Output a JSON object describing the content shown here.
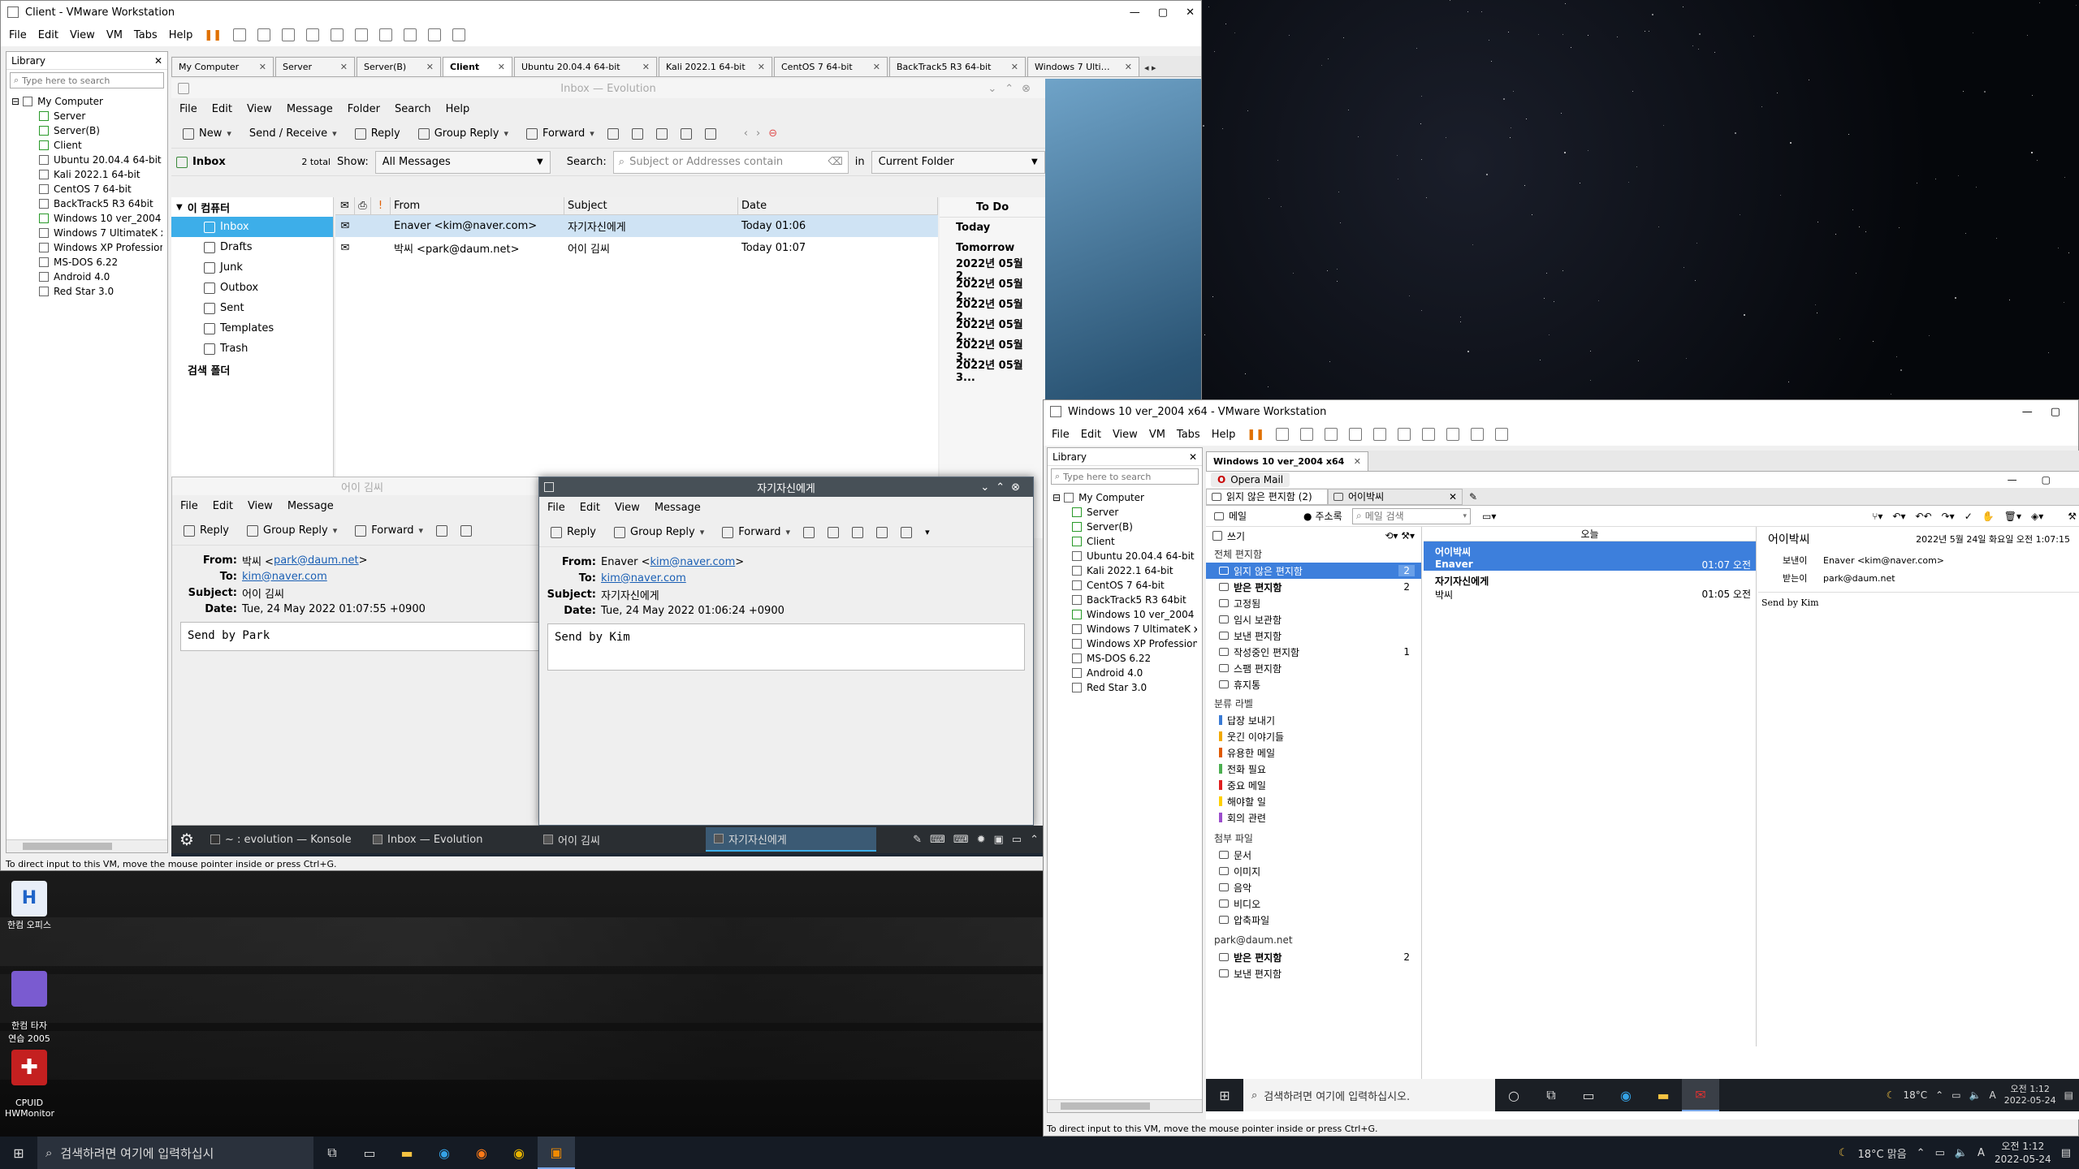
{
  "host": {
    "desktop_icons": [
      {
        "label": "한컴 오피스"
      },
      {
        "label": "한컴 타자\n연습 2005"
      },
      {
        "label": "CPUID\nHWMonitor"
      }
    ],
    "taskbar": {
      "search_placeholder": "검색하려면 여기에 입력하십시",
      "weather": "18°C 맑음",
      "time": "오전 1:12",
      "date": "2022-05-24"
    }
  },
  "vm1": {
    "title": "Client - VMware Workstation",
    "menu": [
      "File",
      "Edit",
      "View",
      "VM",
      "Tabs",
      "Help"
    ],
    "library": {
      "title": "Library",
      "search_placeholder": "Type here to search",
      "root": "My Computer",
      "items": [
        "Server",
        "Server(B)",
        "Client",
        "Ubuntu 20.04.4 64-bit",
        "Kali 2022.1 64-bit",
        "CentOS 7 64-bit",
        "BackTrack5 R3 64bit",
        "Windows 10 ver_2004 x",
        "Windows 7 UltimateK x",
        "Windows XP Profession",
        "MS-DOS 6.22",
        "Android 4.0",
        "Red Star 3.0"
      ]
    },
    "tabs": [
      "My Computer",
      "Server",
      "Server(B)",
      "Client",
      "Ubuntu 20.04.4 64-bit",
      "Kali 2022.1 64-bit",
      "CentOS 7 64-bit",
      "BackTrack5 R3 64-bit",
      "Windows 7 Ultima..."
    ],
    "status": "To direct input to this VM, move the mouse pointer inside or press Ctrl+G."
  },
  "evolution": {
    "title": "Inbox — Evolution",
    "menu": [
      "File",
      "Edit",
      "View",
      "Message",
      "Folder",
      "Search",
      "Help"
    ],
    "toolbar": {
      "new": "New",
      "send_receive": "Send / Receive",
      "reply": "Reply",
      "group_reply": "Group Reply",
      "forward": "Forward"
    },
    "inbox_label": "Inbox",
    "total": "2 total",
    "show_label": "Show:",
    "show_value": "All Messages",
    "search_label": "Search:",
    "search_placeholder": "Subject or Addresses contain",
    "in_label": "in",
    "scope": "Current Folder",
    "account": "이 컴퓨터",
    "folders": [
      "Inbox",
      "Drafts",
      "Junk",
      "Outbox",
      "Sent",
      "Templates",
      "Trash"
    ],
    "search_folders": "검색 폴더",
    "columns": {
      "from": "From",
      "subject": "Subject",
      "date": "Date"
    },
    "messages": [
      {
        "from": "Enaver <kim@naver.com>",
        "subject": "자기자신에게",
        "date": "Today 01:06"
      },
      {
        "from": "박씨 <park@daum.net>",
        "subject": "어이 김씨",
        "date": "Today 01:07"
      }
    ],
    "todo": {
      "title": "To Do",
      "items": [
        "Today",
        "Tomorrow",
        "2022년 05월 2...",
        "2022년 05월 2...",
        "2022년 05월 2...",
        "2022년 05월 2...",
        "2022년 05월 3...",
        "2022년 05월 3..."
      ]
    }
  },
  "compose_park": {
    "title": "어이 김씨",
    "menu": [
      "File",
      "Edit",
      "View",
      "Message"
    ],
    "toolbar": {
      "reply": "Reply",
      "group_reply": "Group Reply",
      "forward": "Forward"
    },
    "from_label": "From:",
    "from_name": "박씨 <",
    "from_addr": "park@daum.net",
    "from_end": ">",
    "to_label": "To:",
    "to_addr": "kim@naver.com",
    "subject_label": "Subject:",
    "subject": "어이 김씨",
    "date_label": "Date:",
    "date": "Tue, 24 May 2022 01:07:55 +0900",
    "body": "Send by Park"
  },
  "compose_kim": {
    "title": "자기자신에게",
    "menu": [
      "File",
      "Edit",
      "View",
      "Message"
    ],
    "toolbar": {
      "reply": "Reply",
      "group_reply": "Group Reply",
      "forward": "Forward"
    },
    "from_label": "From:",
    "from_name": "Enaver <",
    "from_addr": "kim@naver.com",
    "from_end": ">",
    "to_label": "To:",
    "to_addr": "kim@naver.com",
    "subject_label": "Subject:",
    "subject": "자기자신에게",
    "date_label": "Date:",
    "date": "Tue, 24 May 2022 01:06:24 +0900",
    "body": "Send by Kim"
  },
  "kde_panel": {
    "tasks": [
      "~ : evolution — Konsole",
      "Inbox — Evolution",
      "어이 김씨",
      "자기자신에게"
    ]
  },
  "vm2": {
    "title": "Windows 10 ver_2004 x64 - VMware Workstation",
    "menu": [
      "File",
      "Edit",
      "View",
      "VM",
      "Tabs",
      "Help"
    ],
    "library": {
      "title": "Library",
      "search_placeholder": "Type here to search",
      "root": "My Computer",
      "items": [
        "Server",
        "Server(B)",
        "Client",
        "Ubuntu 20.04.4 64-bit",
        "Kali 2022.1 64-bit",
        "CentOS 7 64-bit",
        "BackTrack5 R3 64bit",
        "Windows 10 ver_2004",
        "Windows 7 UltimateK x",
        "Windows XP Profession",
        "MS-DOS 6.22",
        "Android 4.0",
        "Red Star 3.0"
      ]
    },
    "tab": "Windows 10 ver_2004 x64",
    "status": "To direct input to this VM, move the mouse pointer inside or press Ctrl+G."
  },
  "opera": {
    "title": "Opera Mail",
    "tab_unread": "읽지 않은 편지함 (2)",
    "tab_msg": "어이박씨",
    "mail_label": "메일",
    "addressbook": "주소록",
    "mail_search": "메일 검색",
    "compose": "쓰기",
    "all_mail_header": "전체 편지함",
    "folders": [
      {
        "name": "읽지 않은 편지함",
        "count": "2"
      },
      {
        "name": "받은 편지함",
        "count": "2"
      },
      {
        "name": "고정됨",
        "count": ""
      },
      {
        "name": "임시 보관함",
        "count": ""
      },
      {
        "name": "보낸 편지함",
        "count": ""
      },
      {
        "name": "작성중인 편지함",
        "count": "1"
      },
      {
        "name": "스팸 편지함",
        "count": ""
      },
      {
        "name": "휴지통",
        "count": ""
      }
    ],
    "labels_header": "분류 라벨",
    "labels": [
      {
        "name": "답장 보내기",
        "color": "#3a7bd5"
      },
      {
        "name": "웃긴 이야기들",
        "color": "#f2a900"
      },
      {
        "name": "유용한 메일",
        "color": "#e05a00"
      },
      {
        "name": "전화 필요",
        "color": "#4caf50"
      },
      {
        "name": "중요 메일",
        "color": "#e02020"
      },
      {
        "name": "해야할 일",
        "color": "#ffd000"
      },
      {
        "name": "회의 관련",
        "color": "#9c4dcc"
      }
    ],
    "attach_header": "첨부 파일",
    "attachments": [
      "문서",
      "이미지",
      "음악",
      "비디오",
      "압축파일"
    ],
    "account_header": "park@daum.net",
    "account_folders": [
      {
        "name": "받은 편지함",
        "count": "2"
      },
      {
        "name": "보낸 편지함",
        "count": ""
      }
    ],
    "list_header": "오늘",
    "list": [
      {
        "subject": "어이박씨",
        "from": "Enaver",
        "time": "01:07 오전",
        "selected": true
      },
      {
        "subject": "자기자신에게",
        "from": "박씨",
        "time": "01:05 오전",
        "selected": false
      }
    ],
    "preview": {
      "subject": "어이박씨",
      "date": "2022년 5월 24일 화요일 오전 1:07:15",
      "from_label": "보낸이",
      "from": "Enaver <kim@naver.com>",
      "to_label": "받는이",
      "to": "park@daum.net",
      "body": "Send by Kim"
    }
  },
  "guest_taskbar": {
    "search_placeholder": "검색하려면 여기에 입력하십시오.",
    "temp": "18°C",
    "time": "오전 1:12",
    "date": "2022-05-24"
  }
}
